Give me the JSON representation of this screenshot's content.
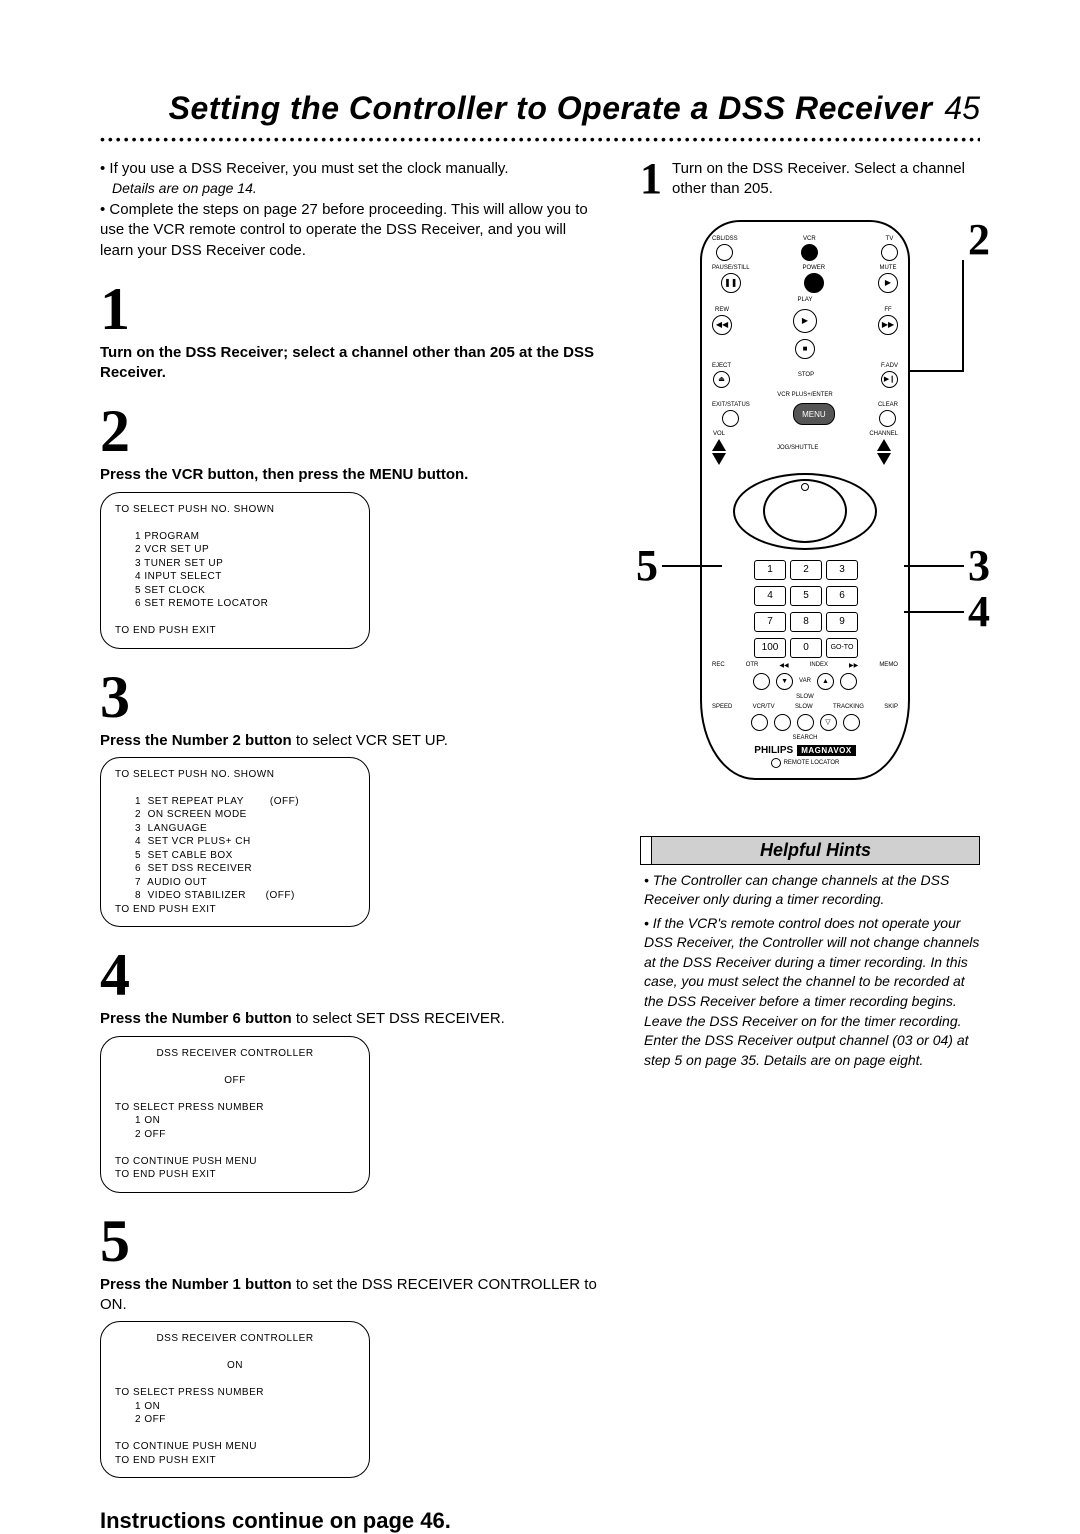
{
  "header": {
    "title": "Setting the Controller to Operate a DSS Receiver",
    "page_number": "45"
  },
  "intro": {
    "bullets": [
      "If you use a DSS Receiver, you must set the clock manually.",
      "Complete the steps on page 27 before proceeding. This will allow you to use the VCR remote control to operate the DSS Receiver, and you will learn your DSS Receiver code."
    ],
    "details_note": "Details are on page 14."
  },
  "steps": {
    "s1": {
      "num": "1",
      "text_bold": "Turn on the DSS Receiver; select a channel other than 205 at the DSS Receiver."
    },
    "s2": {
      "num": "2",
      "text_bold": "Press the VCR button, then press the MENU button.",
      "screen": {
        "header": "TO SELECT PUSH NO. SHOWN",
        "items": [
          "1  PROGRAM",
          "2  VCR SET UP",
          "3  TUNER SET UP",
          "4  INPUT SELECT",
          "5  SET CLOCK",
          "6  SET REMOTE LOCATOR"
        ],
        "footer": "TO END PUSH EXIT"
      }
    },
    "s3": {
      "num": "3",
      "text_bold": "Press the Number 2 button",
      "text_rest": " to select VCR SET UP.",
      "screen": {
        "header": "TO SELECT PUSH NO. SHOWN",
        "items": [
          "1  SET REPEAT PLAY        (OFF)",
          "2  ON SCREEN MODE",
          "3  LANGUAGE",
          "4  SET VCR PLUS+ CH",
          "5  SET CABLE BOX",
          "6  SET DSS RECEIVER",
          "7  AUDIO OUT",
          "8  VIDEO STABILIZER      (OFF)"
        ],
        "footer": "TO END PUSH EXIT"
      }
    },
    "s4": {
      "num": "4",
      "text_bold": "Press the Number 6 button",
      "text_rest": " to select SET DSS RECEIVER.",
      "screen": {
        "title": "DSS RECEIVER CONTROLLER",
        "state": "OFF",
        "header": "TO SELECT PRESS NUMBER",
        "items": [
          "1  ON",
          "2  OFF"
        ],
        "footer1": "TO CONTINUE PUSH MENU",
        "footer2": "TO END PUSH EXIT"
      }
    },
    "s5": {
      "num": "5",
      "text_bold": "Press the Number 1 button",
      "text_rest": " to set the DSS RECEIVER CONTROLLER to ON.",
      "screen": {
        "title": "DSS RECEIVER CONTROLLER",
        "state": "ON",
        "header": "TO SELECT PRESS NUMBER",
        "items": [
          "1  ON",
          "2  OFF"
        ],
        "footer1": "TO CONTINUE PUSH MENU",
        "footer2": "TO END PUSH EXIT"
      }
    }
  },
  "continue_note": "Instructions continue on page 46.",
  "right": {
    "step1": {
      "num": "1",
      "text": "Turn on the DSS Receiver. Select a channel other than 205."
    },
    "callouts": {
      "c2": "2",
      "c3": "3",
      "c4": "4",
      "c5": "5"
    }
  },
  "remote": {
    "top_row": [
      "CBL/DSS",
      "VCR",
      "TV"
    ],
    "power": "POWER",
    "pause": "PAUSE/STILL",
    "mute": "MUTE",
    "play": "PLAY",
    "rew": "REW",
    "ff": "FF",
    "eject": "EJECT",
    "stop": "STOP",
    "fadv": "F.ADV",
    "vcrplus": "VCR PLUS+/ENTER",
    "exit": "EXIT/STATUS",
    "clear": "CLEAR",
    "menu": "MENU",
    "vol": "VOL",
    "jog": "JOG/SHUTTLE",
    "ch": "CHANNEL",
    "keypad": [
      "1",
      "2",
      "3",
      "4",
      "5",
      "6",
      "7",
      "8",
      "9",
      "100",
      "0",
      "GO-TO"
    ],
    "bottom_row1": [
      "REC",
      "OTR",
      "INDEX",
      "MEMO"
    ],
    "var": "VAR",
    "slow": "SLOW",
    "bottom_row2": [
      "SPEED",
      "VCR/TV",
      "SLOW",
      "TRACKING",
      "SKIP"
    ],
    "search": "SEARCH",
    "brand": "PHILIPS",
    "brand2": "MAGNAVOX",
    "locator": "REMOTE LOCATOR"
  },
  "hints": {
    "title": "Helpful Hints",
    "items": [
      "The Controller can change channels at the DSS Receiver only during a timer recording.",
      "If the VCR's remote control does not operate your DSS Receiver, the Controller will not change channels at the DSS Receiver during a timer recording. In this case, you must select the channel to be recorded at the DSS Receiver before a timer recording begins. Leave the DSS Receiver on for the timer recording. Enter the DSS Receiver output channel (03 or 04) at step 5 on page 35. Details are on page eight."
    ]
  }
}
